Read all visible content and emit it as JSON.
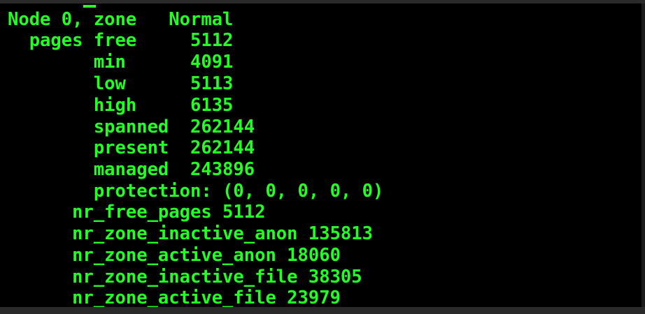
{
  "terminal": {
    "text_color": "#22ff22",
    "background_color": "#000000",
    "lines": [
      "Node 0, zone   Normal",
      "  pages free     5112",
      "        min      4091",
      "        low      5113",
      "        high     6135",
      "        spanned  262144",
      "        present  262144",
      "        managed  243896",
      "        protection: (0, 0, 0, 0, 0)",
      "      nr_free_pages 5112",
      "      nr_zone_inactive_anon 135813",
      "      nr_zone_active_anon 18060",
      "      nr_zone_inactive_file 38305",
      "      nr_zone_active_file 23979"
    ]
  }
}
